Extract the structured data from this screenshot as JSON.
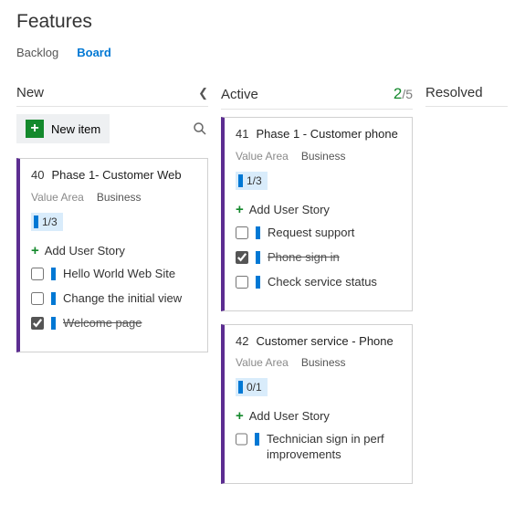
{
  "title": "Features",
  "tabs": {
    "backlog": "Backlog",
    "board": "Board"
  },
  "newitem_label": "New item",
  "add_story_label": "Add User Story",
  "columns": {
    "new": {
      "label": "New"
    },
    "active": {
      "label": "Active",
      "wip_current": "2",
      "wip_limit": "5"
    },
    "resolved": {
      "label": "Resolved"
    }
  },
  "cards": {
    "c40": {
      "id": "40",
      "title": "Phase 1- Customer Web",
      "value_area_label": "Value Area",
      "value_area": "Business",
      "progress": "1/3",
      "stories": [
        {
          "label": "Hello World Web Site",
          "done": false
        },
        {
          "label": "Change the initial view",
          "done": false
        },
        {
          "label": "Welcome page",
          "done": true
        }
      ]
    },
    "c41": {
      "id": "41",
      "title": "Phase 1 - Customer phone",
      "value_area_label": "Value Area",
      "value_area": "Business",
      "progress": "1/3",
      "stories": [
        {
          "label": "Request support",
          "done": false
        },
        {
          "label": "Phone sign in",
          "done": true
        },
        {
          "label": "Check service status",
          "done": false
        }
      ]
    },
    "c42": {
      "id": "42",
      "title": "Customer service - Phone",
      "value_area_label": "Value Area",
      "value_area": "Business",
      "progress": "0/1",
      "stories": [
        {
          "label": "Technician sign in perf improvements",
          "done": false
        }
      ]
    }
  }
}
